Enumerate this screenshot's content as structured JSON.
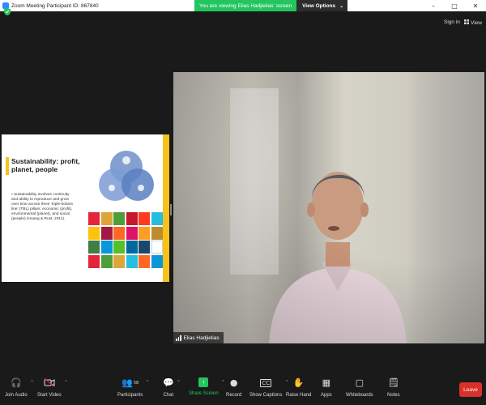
{
  "window": {
    "title": "Zoom Meeting Participant ID: 867840",
    "controls": [
      "–",
      "□",
      "✕"
    ]
  },
  "banner": {
    "viewing_text": "You are viewing Elias Hadjielias' screen",
    "view_options": "View Options"
  },
  "topbar": {
    "sign_in": "Sign in",
    "view": "View"
  },
  "slide": {
    "title": "Sustainability: profit, planet, people",
    "body": "• Sustainability involves continuity and ability to reproduce and grow over time across three 'triple-bottom line' (TBL) pillars: economic (profit), environmental (planet), and social (people) (Huang & Rust, 2011).",
    "sdg_colors": [
      "#e5243b",
      "#dda63a",
      "#4c9f38",
      "#c5192d",
      "#ff3a21",
      "#26bde2",
      "#fcc30b",
      "#a21942",
      "#fd6925",
      "#dd1367",
      "#fd9d24",
      "#bf8b2e",
      "#3f7e44",
      "#0a97d9",
      "#56c02b",
      "#00689d",
      "#19486a",
      "#ffffff",
      "#e5243b",
      "#4c9f38",
      "#dda63a",
      "#26bde2",
      "#fd6925",
      "#0a97d9"
    ]
  },
  "video": {
    "participant_name": "Elias Hadjielias"
  },
  "toolbar": {
    "join_audio": "Join Audio",
    "start_video": "Start Video",
    "participants": "Participants",
    "participants_count": "58",
    "chat": "Chat",
    "share_screen": "Share Screen",
    "record": "Record",
    "show_captions": "Show Captions",
    "raise_hand": "Raise Hand",
    "apps": "Apps",
    "whiteboards": "Whiteboards",
    "notes": "Notes",
    "leave": "Leave"
  }
}
